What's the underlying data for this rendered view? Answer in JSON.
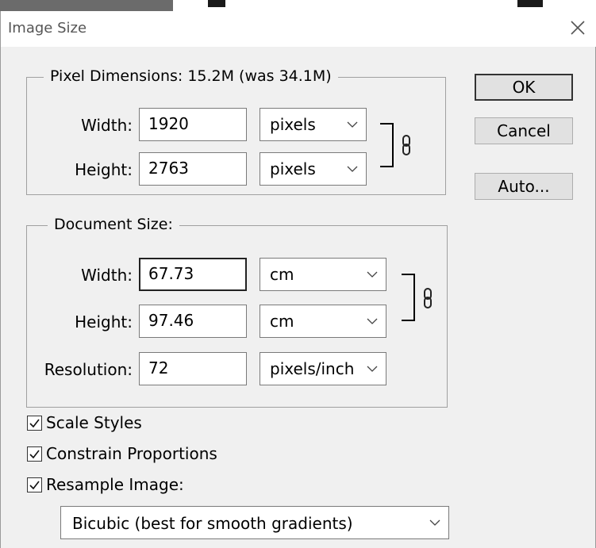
{
  "dialog": {
    "title": "Image Size",
    "close_icon": "close-icon"
  },
  "pixel_dimensions": {
    "legend": "Pixel Dimensions:  15.2M (was 34.1M)",
    "width_label": "Width:",
    "width_value": "1920",
    "width_unit": "pixels",
    "height_label": "Height:",
    "height_value": "2763",
    "height_unit": "pixels",
    "link_icon": "chain-link-icon"
  },
  "document_size": {
    "legend": "Document Size:",
    "width_label": "Width:",
    "width_value": "67.73",
    "width_unit": "cm",
    "height_label": "Height:",
    "height_value": "97.46",
    "height_unit": "cm",
    "resolution_label": "Resolution:",
    "resolution_value": "72",
    "resolution_unit": "pixels/inch",
    "link_icon": "chain-link-icon"
  },
  "buttons": {
    "ok": "OK",
    "cancel": "Cancel",
    "auto": "Auto..."
  },
  "options": {
    "scale_styles": {
      "label": "Scale Styles",
      "checked": true
    },
    "constrain_proportions": {
      "label": "Constrain Proportions",
      "checked": true
    },
    "resample_image": {
      "label": "Resample Image:",
      "checked": true
    }
  },
  "resample_method": "Bicubic (best for smooth gradients)",
  "icons": {
    "dropdown": "chevron-down-icon",
    "checkmark": "checkmark-icon"
  }
}
